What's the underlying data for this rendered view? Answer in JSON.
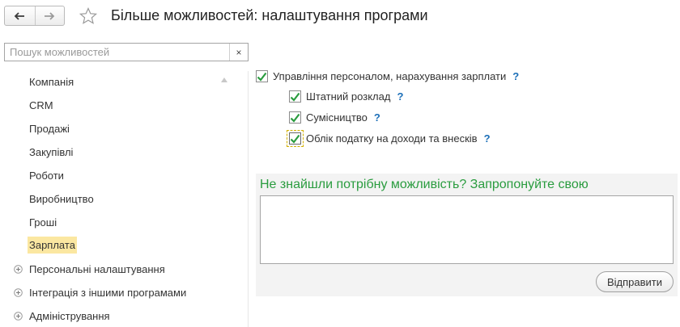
{
  "header": {
    "title": "Більше можливостей: налаштування програми",
    "back_icon": "arrow-left-icon",
    "forward_icon": "arrow-right-icon",
    "favorite_icon": "star-icon"
  },
  "search": {
    "placeholder": "Пошук можливостей",
    "value": "",
    "clear_label": "×"
  },
  "sidebar": {
    "items": [
      {
        "label": "Компанія",
        "expandable": false,
        "selected": false
      },
      {
        "label": "CRM",
        "expandable": false,
        "selected": false
      },
      {
        "label": "Продажі",
        "expandable": false,
        "selected": false
      },
      {
        "label": "Закупівлі",
        "expandable": false,
        "selected": false
      },
      {
        "label": "Роботи",
        "expandable": false,
        "selected": false
      },
      {
        "label": "Виробництво",
        "expandable": false,
        "selected": false
      },
      {
        "label": "Гроші",
        "expandable": false,
        "selected": false
      },
      {
        "label": "Зарплата",
        "expandable": false,
        "selected": true
      },
      {
        "label": "Персональні налаштування",
        "expandable": true,
        "selected": false
      },
      {
        "label": "Інтеграція з іншими програмами",
        "expandable": true,
        "selected": false
      },
      {
        "label": "Адміністрування",
        "expandable": true,
        "selected": false
      }
    ]
  },
  "options": {
    "payroll": {
      "label": "Управління персоналом, нарахування зарплати",
      "checked": true,
      "help": "?"
    },
    "staffing": {
      "label": "Штатний розклад",
      "checked": true,
      "help": "?"
    },
    "part_time": {
      "label": "Сумісництво",
      "checked": true,
      "help": "?"
    },
    "tax": {
      "label": "Облік податку на доходи та внесків",
      "checked": true,
      "help": "?"
    }
  },
  "suggest": {
    "title": "Не знайшли потрібну можливість? Запропонуйте свою",
    "text": "",
    "send_label": "Відправити"
  },
  "colors": {
    "check": "#2a9c3f",
    "help": "#1c6fb8",
    "selected_bg": "#fbe7a1",
    "suggest_title": "#2a9c3f"
  }
}
